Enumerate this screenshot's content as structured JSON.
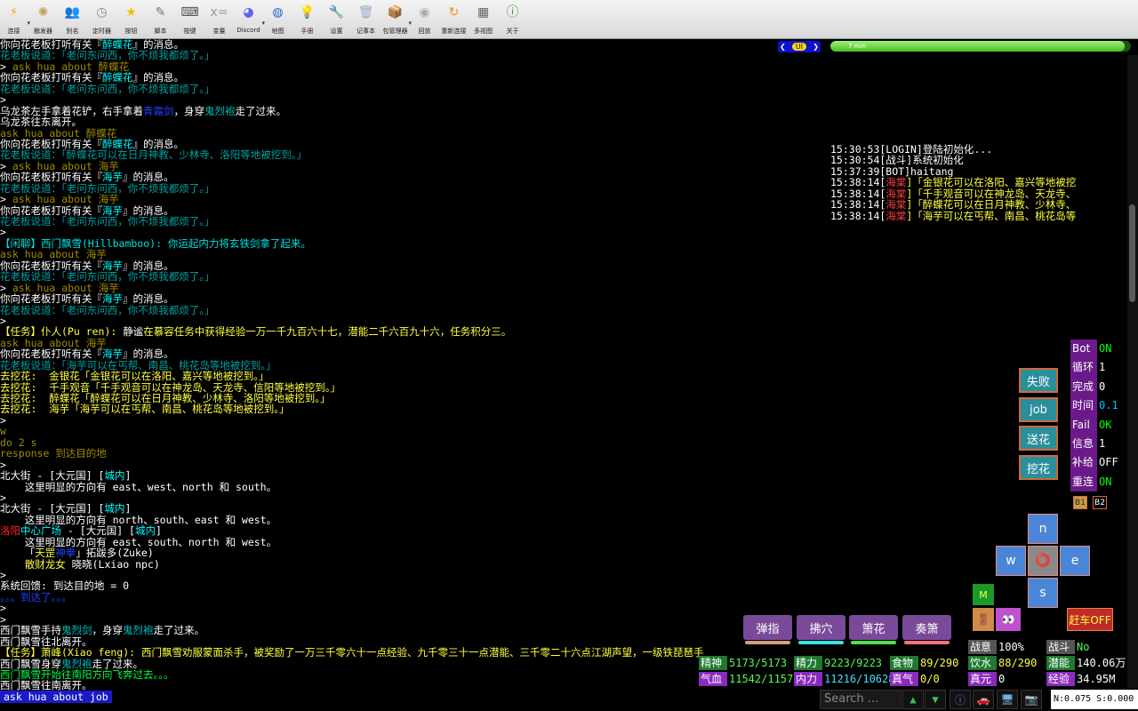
{
  "toolbar": [
    {
      "label": "连接",
      "icon": "lightning-icon",
      "glyph": "⚡",
      "color": "#f0b400",
      "dd": true
    },
    {
      "label": "触发器",
      "icon": "satellite-icon",
      "glyph": "✺",
      "color": "#caa060"
    },
    {
      "label": "别名",
      "icon": "users-icon",
      "glyph": "👥",
      "color": "#c89060"
    },
    {
      "label": "定时器",
      "icon": "clock-icon",
      "glyph": "◷",
      "color": "#888"
    },
    {
      "label": "按钮",
      "icon": "star-icon",
      "glyph": "★",
      "color": "#f0c000"
    },
    {
      "label": "脚本",
      "icon": "script-icon",
      "glyph": "✎",
      "color": "#777"
    },
    {
      "label": "按键",
      "icon": "keyboard-icon",
      "glyph": "⌨",
      "color": "#555"
    },
    {
      "label": "变量",
      "icon": "variable-icon",
      "glyph": "x=",
      "color": "#999"
    },
    {
      "label": "Discord",
      "icon": "discord-icon",
      "glyph": "◕",
      "color": "#5865f2",
      "dd": true
    },
    {
      "label": "地图",
      "icon": "globe-icon",
      "glyph": "◍",
      "color": "#2a6ad0"
    },
    {
      "label": "手册",
      "icon": "lightbulb-icon",
      "glyph": "💡",
      "color": "#f0d040"
    },
    {
      "label": "设置",
      "icon": "wrench-icon",
      "glyph": "🔧",
      "color": "#888"
    },
    {
      "label": "记事本",
      "icon": "trash-notepad-icon",
      "glyph": "🗑",
      "color": "#9ac"
    },
    {
      "label": "包管理器",
      "icon": "package-icon",
      "glyph": "📦",
      "color": "#b07a40",
      "dd": true
    },
    {
      "label": "回放",
      "icon": "disc-icon",
      "glyph": "◉",
      "color": "#aaa"
    },
    {
      "label": "重新连接",
      "icon": "reconnect-icon",
      "glyph": "↻",
      "color": "#f09020"
    },
    {
      "label": "多视图",
      "icon": "multiview-icon",
      "glyph": "▦",
      "color": "#666"
    },
    {
      "label": "关于",
      "icon": "about-icon",
      "glyph": "ⓘ",
      "color": "#3a9a3a"
    }
  ],
  "terminal": [
    [
      [
        "你向花老板打听有关『",
        "#fff"
      ],
      [
        "醉蝶花",
        "#00ffff"
      ],
      [
        "』的消息。",
        "#fff"
      ]
    ],
    [
      [
        "花老板说道：「老问东问西，你不烦我都烦了。」",
        "#00a0a0"
      ]
    ],
    [
      [
        "> ",
        "#fff"
      ],
      [
        "ask hua about 醉蝶花",
        "#a08a00"
      ]
    ],
    [
      [
        "你向花老板打听有关『",
        "#fff"
      ],
      [
        "醉蝶花",
        "#00ffff"
      ],
      [
        "』的消息。",
        "#fff"
      ]
    ],
    [
      [
        "花老板说道：「老问东问西，你不烦我都烦了。」",
        "#00a0a0"
      ]
    ],
    [
      [
        ">",
        "#fff"
      ]
    ],
    [
      [
        "乌龙茶左手拿着花铲，右手拿着",
        "#fff"
      ],
      [
        "青霜剑",
        "#2040ff"
      ],
      [
        "，身穿",
        "#fff"
      ],
      [
        "鬼烈袍",
        "#00c0c0"
      ],
      [
        "走了过来。",
        "#fff"
      ]
    ],
    [
      [
        "乌龙茶往东离开。",
        "#fff"
      ]
    ],
    [
      [
        "ask hua about 醉蝶花",
        "#a08a00"
      ]
    ],
    [
      [
        "你向花老板打听有关『",
        "#fff"
      ],
      [
        "醉蝶花",
        "#00ffff"
      ],
      [
        "』的消息。",
        "#fff"
      ]
    ],
    [
      [
        "花老板说道：「醉蝶花可以在日月神教、少林寺、洛阳等地被挖到。」",
        "#00a0a0"
      ]
    ],
    [
      [
        "> ",
        "#fff"
      ],
      [
        "ask hua about 海芋",
        "#a08a00"
      ]
    ],
    [
      [
        "你向花老板打听有关『",
        "#fff"
      ],
      [
        "海芋",
        "#00ffff"
      ],
      [
        "』的消息。",
        "#fff"
      ]
    ],
    [
      [
        "花老板说道：「老问东问西，你不烦我都烦了。」",
        "#00a0a0"
      ]
    ],
    [
      [
        "> ",
        "#fff"
      ],
      [
        "ask hua about 海芋",
        "#a08a00"
      ]
    ],
    [
      [
        "你向花老板打听有关『",
        "#fff"
      ],
      [
        "海芋",
        "#00ffff"
      ],
      [
        "』的消息。",
        "#fff"
      ]
    ],
    [
      [
        "花老板说道：「老问东问西，你不烦我都烦了。」",
        "#00a0a0"
      ]
    ],
    [
      [
        ">",
        "#fff"
      ]
    ],
    [
      [
        "【闲聊】西门飘雪(Hillbamboo): 你运起内力将玄铁剑拿了起来。",
        "#00e0e0"
      ]
    ],
    [
      [
        "ask hua about 海芋",
        "#a08a00"
      ]
    ],
    [
      [
        "你向花老板打听有关『",
        "#fff"
      ],
      [
        "海芋",
        "#00ffff"
      ],
      [
        "』的消息。",
        "#fff"
      ]
    ],
    [
      [
        "花老板说道：「老问东问西，你不烦我都烦了。」",
        "#00a0a0"
      ]
    ],
    [
      [
        "> ",
        "#fff"
      ],
      [
        "ask hua about 海芋",
        "#a08a00"
      ]
    ],
    [
      [
        "你向花老板打听有关『",
        "#fff"
      ],
      [
        "海芋",
        "#00ffff"
      ],
      [
        "』的消息。",
        "#fff"
      ]
    ],
    [
      [
        "花老板说道：「老问东问西，你不烦我都烦了。」",
        "#00a0a0"
      ]
    ],
    [
      [
        ">",
        "#fff"
      ]
    ],
    [
      [
        "【任务】仆人(Pu ren): ",
        "#ffff40"
      ],
      [
        "静谧",
        "#ffffff"
      ],
      [
        "在慕容任务中获得经验一万一千九百六十七，潜能二千六百九十六，任务积分三。",
        "#ffff40"
      ]
    ],
    [
      [
        "ask hua about 海芋",
        "#a08a00"
      ]
    ],
    [
      [
        "你向花老板打听有关『",
        "#fff"
      ],
      [
        "海芋",
        "#00ffff"
      ],
      [
        "』的消息。",
        "#fff"
      ]
    ],
    [
      [
        "花老板说道：「海芋可以在丐帮、南昌、桃花岛等地被挖到。」",
        "#00a0a0"
      ]
    ],
    [
      [
        "去挖花:  金银花「金银花可以在洛阳、嘉兴等地被挖到。」",
        "#ffff40"
      ]
    ],
    [
      [
        "去挖花:  千手观音「千手观音可以在神龙岛、天龙寺、信阳等地被挖到。」",
        "#ffff40"
      ]
    ],
    [
      [
        "去挖花:  醉蝶花「醉蝶花可以在日月神教、少林寺、洛阳等地被挖到。」",
        "#ffff40"
      ]
    ],
    [
      [
        "去挖花:  海芋「海芋可以在丐帮、南昌、桃花岛等地被挖到。」",
        "#ffff40"
      ]
    ],
    [
      [
        ">",
        "#fff"
      ]
    ],
    [
      [
        "w",
        "#a08a00"
      ]
    ],
    [
      [
        "do 2 s",
        "#a08a00"
      ]
    ],
    [
      [
        "response 到达目的地",
        "#a08a00"
      ]
    ],
    [
      [
        ">",
        "#fff"
      ]
    ],
    [
      [
        "北大街 - [大元国] [",
        "#fff"
      ],
      [
        "城内",
        "#00ffff"
      ],
      [
        "]",
        "#fff"
      ]
    ],
    [
      [
        "    这里明显的方向有 east、west、north 和 south。",
        "#fff"
      ]
    ],
    [
      [
        ">",
        "#fff"
      ]
    ],
    [
      [
        "北大街 - [大元国] [",
        "#fff"
      ],
      [
        "城内",
        "#00ffff"
      ],
      [
        "]",
        "#fff"
      ]
    ],
    [
      [
        "    这里明显的方向有 north、south、east 和 west。",
        "#fff"
      ]
    ],
    [
      [
        "洛阳",
        "#ff2020"
      ],
      [
        "中心广场",
        "#00ffff"
      ],
      [
        " - [大元国] [",
        "#fff"
      ],
      [
        "城内",
        "#00ffff"
      ],
      [
        "]",
        "#fff"
      ]
    ],
    [
      [
        "    这里明显的方向有 east、south、north 和 west。",
        "#fff"
      ]
    ],
    [
      [
        "    「",
        "#fff"
      ],
      [
        "天罡",
        "#ffff40"
      ],
      [
        "神拳",
        "#2040ff"
      ],
      [
        "」拓跋多(Zuke)",
        "#fff"
      ]
    ],
    [
      [
        "    ",
        "#fff"
      ],
      [
        "散财龙女",
        "#ffff40"
      ],
      [
        " 晓晓(Lxiao npc)",
        "#fff"
      ]
    ],
    [
      [
        ">",
        "#fff"
      ]
    ],
    [
      [
        "系统回馈: 到达目的地 = 0",
        "#fff"
      ]
    ],
    [
      [
        "。。。到达了。。。",
        "#2040ff"
      ]
    ],
    [
      [
        ">",
        "#fff"
      ]
    ],
    [
      [
        ">",
        "#fff"
      ]
    ],
    [
      [
        "西门飘雪手持",
        "#fff"
      ],
      [
        "鬼烈剑",
        "#00c0c0"
      ],
      [
        "，身穿",
        "#fff"
      ],
      [
        "鬼烈袍",
        "#00c0c0"
      ],
      [
        "走了过来。",
        "#fff"
      ]
    ],
    [
      [
        "西门飘雪往北离开。",
        "#fff"
      ]
    ],
    [
      [
        "【任务】萧峰(Xiao feng): 西门飘雪劝服蒙面杀手，被奖励了一万三千零六十一点经验、九千零三十一点潜能、三千零二十六点江湖声望，一级铁琵琶手",
        "#ffff40"
      ]
    ],
    [
      [
        "西门飘雪身穿",
        "#fff"
      ],
      [
        "鬼烈袍",
        "#00c0c0"
      ],
      [
        "走了过来。",
        "#fff"
      ]
    ],
    [
      [
        "西门飘雪开始往南阳方向飞奔过去。。。",
        "#00ff40"
      ]
    ],
    [
      [
        "西门飘雪往南离开。",
        "#fff"
      ]
    ]
  ],
  "command": "ask hua about job",
  "nav": {
    "prev": "❮",
    "ui": "UI",
    "next": "❯"
  },
  "progress": {
    "label": "7 min",
    "fraction": 0.98
  },
  "log": [
    [
      [
        "15:30:53[LOGIN]登陆初始化...",
        "#fff"
      ]
    ],
    [
      [
        "15:30:54[战斗]系统初始化",
        "#fff"
      ]
    ],
    [
      [
        "15:37:39[BOT]haitang",
        "#fff"
      ]
    ],
    [
      [
        "15:38:14[",
        "#fff"
      ],
      [
        "海棠",
        "#ff4040"
      ],
      [
        "]「金银花可以在洛阳、嘉兴等地被挖",
        "#ffff40"
      ]
    ],
    [
      [
        "15:38:14[",
        "#fff"
      ],
      [
        "海棠",
        "#ff4040"
      ],
      [
        "]「千手观音可以在神龙岛、天龙寺、",
        "#ffff40"
      ]
    ],
    [
      [
        "15:38:14[",
        "#fff"
      ],
      [
        "海棠",
        "#ff4040"
      ],
      [
        "]「醉蝶花可以在日月神教、少林寺、",
        "#ffff40"
      ]
    ],
    [
      [
        "15:38:14[",
        "#fff"
      ],
      [
        "海棠",
        "#ff4040"
      ],
      [
        "]「海芋可以在丐帮、南昌、桃花岛等",
        "#ffff40"
      ]
    ]
  ],
  "bot": [
    {
      "k": "Bot",
      "v": "ON",
      "c": "#00ff00"
    },
    {
      "k": "循环",
      "v": "1",
      "c": "#fff"
    },
    {
      "k": "完成",
      "v": "0",
      "c": "#fff"
    },
    {
      "k": "时间",
      "v": "0.1",
      "c": "#00c0ff"
    },
    {
      "k": "Fail",
      "v": "OK",
      "c": "#00ff00"
    },
    {
      "k": "信息",
      "v": "1",
      "c": "#fff"
    },
    {
      "k": "补给",
      "v": "OFF",
      "c": "#fff"
    },
    {
      "k": "重连",
      "v": "ON",
      "c": "#00ff00"
    }
  ],
  "actions": [
    "失败",
    "job",
    "送花",
    "挖花"
  ],
  "bbuttons": [
    "B1",
    "B2"
  ],
  "dirs": {
    "n": "n",
    "w": "w",
    "e": "e",
    "s": "s",
    "center": "⭕"
  },
  "m_label": "M",
  "eyes": "👀",
  "door": "🚪",
  "autocar": "赶车OFF",
  "skills": [
    {
      "label": "弹指",
      "bar": "#d0a080"
    },
    {
      "label": "拂穴",
      "bar": "#40e0e0"
    },
    {
      "label": "箫花",
      "bar": "#50e050"
    },
    {
      "label": "奏箫",
      "bar": "#ff7080"
    }
  ],
  "stats": {
    "jingshen": {
      "k": "精神",
      "v": "5173/5173"
    },
    "jingli": {
      "k": "精力",
      "v": "9223/9223"
    },
    "shiwu": {
      "k": "食物",
      "v": "89/290"
    },
    "yinshui": {
      "k": "饮水",
      "v": "88/290"
    },
    "qianneng": {
      "k": "潜能",
      "v": "140.06万"
    },
    "qixue": {
      "k": "气血",
      "v": "11542/11575"
    },
    "neili": {
      "k": "内力",
      "v": "11216/10628"
    },
    "zhenqi": {
      "k": "真气",
      "v": "0/0"
    },
    "zhenyuan": {
      "k": "真元",
      "v": "0"
    },
    "jingyan": {
      "k": "经验",
      "v": "34.95M"
    },
    "zhanyi": {
      "k": "战意",
      "v": "100%"
    },
    "zhandou": {
      "k": "战斗",
      "v": "No"
    }
  },
  "colors": {
    "stat_green": "#1f7a2e",
    "stat_purple": "#8a2abe",
    "stat_grey": "#555",
    "value_green": "#50ff50",
    "value_yellow": "#ffff40"
  },
  "search": {
    "placeholder": "Search ..."
  },
  "bottom_icons": [
    {
      "icon": "up-arrow-icon",
      "g": "▲",
      "c": "#40c040"
    },
    {
      "icon": "down-arrow-icon",
      "g": "▼",
      "c": "#40c040"
    },
    {
      "icon": "info-icon",
      "g": "ⓘ",
      "c": "#4a8ae0"
    },
    {
      "icon": "car-icon",
      "g": "🚗",
      "c": "#aaa"
    },
    {
      "icon": "monitor-icon",
      "g": "🖥",
      "c": "#7ab0e0"
    },
    {
      "icon": "camera-icon",
      "g": "📷",
      "c": "#aaa"
    }
  ],
  "coords": "N:0.075 S:0.000"
}
